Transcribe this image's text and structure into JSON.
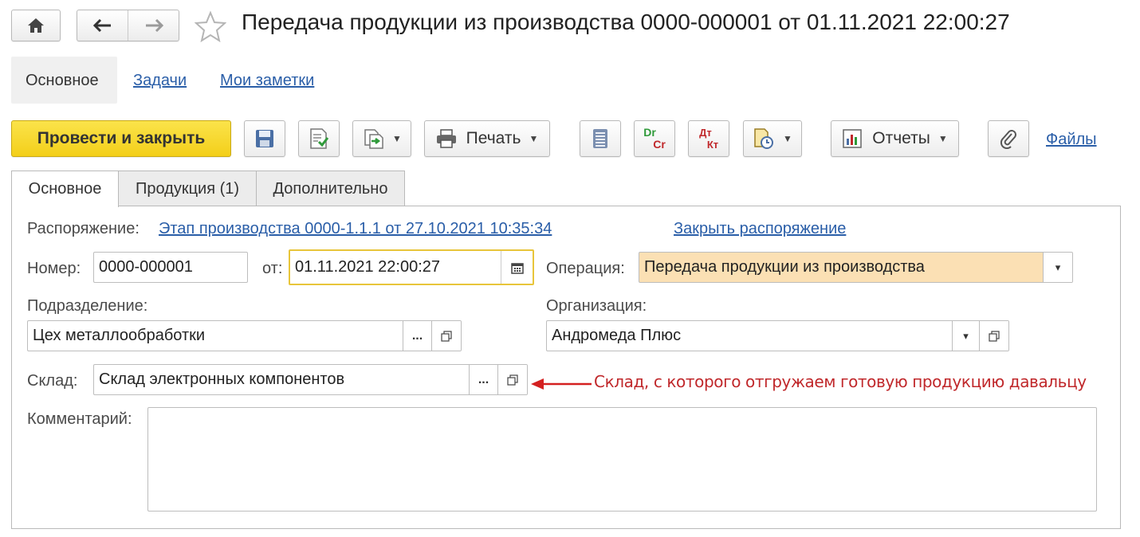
{
  "window": {
    "title": "Передача продукции из производства 0000-000001 от 01.11.2021 22:00:27"
  },
  "icons": {
    "home": "home-icon",
    "back": "arrow-left-icon",
    "forward": "arrow-right-icon",
    "favorite": "star-icon"
  },
  "sections": {
    "main": "Основное",
    "tasks": "Задачи",
    "notes": "Мои заметки"
  },
  "toolbar": {
    "post_close_label": "Провести и закрыть",
    "print_label": "Печать",
    "reports_label": "Отчеты",
    "files_label": "Файлы",
    "dtkt_label_top": "Dr",
    "dtkt_label_bottom": "Cr",
    "dtkt2_label_top": "Дт",
    "dtkt2_label_bottom": "Кт"
  },
  "tabs": [
    {
      "label": "Основное",
      "active": true
    },
    {
      "label": "Продукция (1)",
      "active": false
    },
    {
      "label": "Дополнительно",
      "active": false
    }
  ],
  "form": {
    "order_label": "Распоряжение:",
    "order_link": "Этап производства 0000-1.1.1 от 27.10.2021 10:35:34",
    "close_order_link": "Закрыть распоряжение",
    "number_label": "Номер:",
    "number_value": "0000-000001",
    "date_label": "от:",
    "date_value": "01.11.2021 22:00:27",
    "operation_label": "Операция:",
    "operation_value": "Передача продукции из производства",
    "department_label": "Подразделение:",
    "department_value": "Цех металлообработки",
    "organization_label": "Организация:",
    "organization_value": "Андромеда Плюс",
    "warehouse_label": "Склад:",
    "warehouse_value": "Склад электронных компонентов",
    "comment_label": "Комментарий:",
    "comment_value": "",
    "choose_glyph": "...",
    "dropdown_glyph": "▾"
  },
  "annotation": {
    "text": "Склад, с которого отгружаем готовую продукцию давальцу",
    "color": "#c0282b"
  },
  "colors": {
    "primary_button": "#f5d320",
    "operation_field": "#fbe0b4",
    "date_focus_border": "#e8c53a",
    "link": "#2a5ea8"
  }
}
